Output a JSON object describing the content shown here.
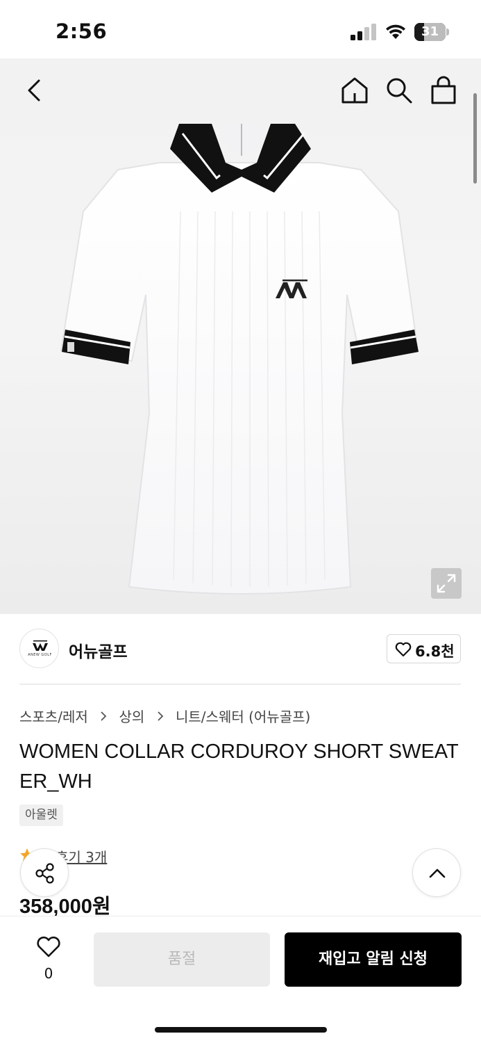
{
  "status_bar": {
    "time": "2:56",
    "battery": "31",
    "battery_level": 0.31
  },
  "header": {
    "back_icon": "chevron-left-icon",
    "home_icon": "home-icon",
    "search_icon": "search-icon",
    "bag_icon": "shopping-bag-icon"
  },
  "product_image": {
    "logo_mark": "AW",
    "expand_icon": "expand-icon"
  },
  "brand": {
    "logo_text": "ANEW GOLF",
    "name": "어뉴골프",
    "like_count": "6.8천"
  },
  "breadcrumb": [
    "스포츠/레저",
    "상의",
    "니트/스웨터 (어뉴골프)"
  ],
  "product": {
    "title": "WOMEN COLLAR CORDUROY SHORT SWEATER_WH",
    "tag": "아울렛",
    "review_link": "후기 3개",
    "price": "358,000원"
  },
  "bottom_bar": {
    "wish_count": "0",
    "soldout_label": "품절",
    "restock_label": "재입고 알림 신청"
  },
  "colors": {
    "accent_star": "#f5a623",
    "primary_button": "#000000",
    "disabled_button": "#ececec",
    "disabled_text": "#b9b9b9"
  }
}
